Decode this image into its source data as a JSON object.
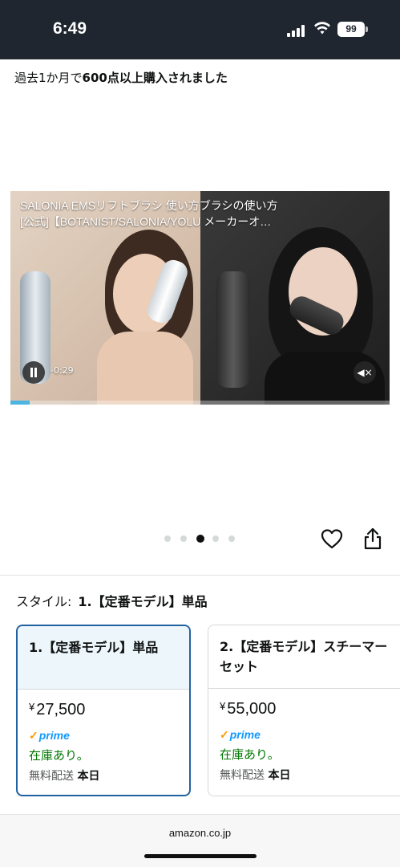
{
  "status_bar": {
    "time": "6:49",
    "battery": "99"
  },
  "purchase": {
    "prefix": "過去1か月で",
    "highlight": "600点以上購入されました"
  },
  "video": {
    "title_line1": "SALONIA EMSリフトブラシ 使い方ブラシの使い方",
    "title_line2": "[公式]【BOTANIST/SALONIA/YOLU メーカーオ…",
    "time_remaining": "-0:29",
    "progress": 0.05
  },
  "carousel": {
    "count": 5,
    "active_index": 2
  },
  "style": {
    "label": "スタイル:",
    "selected": "1.【定番モデル】単品"
  },
  "options": [
    {
      "title": "1.【定番モデル】単品",
      "currency": "¥",
      "price": "27,500",
      "prime": "prime",
      "stock": "在庫あり。",
      "shipping": "無料配送",
      "shipping_when": "本日",
      "selected": true
    },
    {
      "title": "2.【定番モデル】スチーマーセット",
      "currency": "¥",
      "price": "55,000",
      "prime": "prime",
      "stock": "在庫あり。",
      "shipping": "無料配送",
      "shipping_when": "本日",
      "selected": false
    }
  ],
  "browser": {
    "domain": "amazon.co.jp"
  },
  "colors": {
    "status_bar": "#1f262f",
    "selected_border": "#2162a1",
    "stock_green": "#007600",
    "prime_blue": "#1399ff"
  },
  "icons": [
    "signal-icon",
    "wifi-icon",
    "battery-icon",
    "pause-icon",
    "mute-icon",
    "heart-icon",
    "share-icon",
    "prime-check-icon"
  ]
}
